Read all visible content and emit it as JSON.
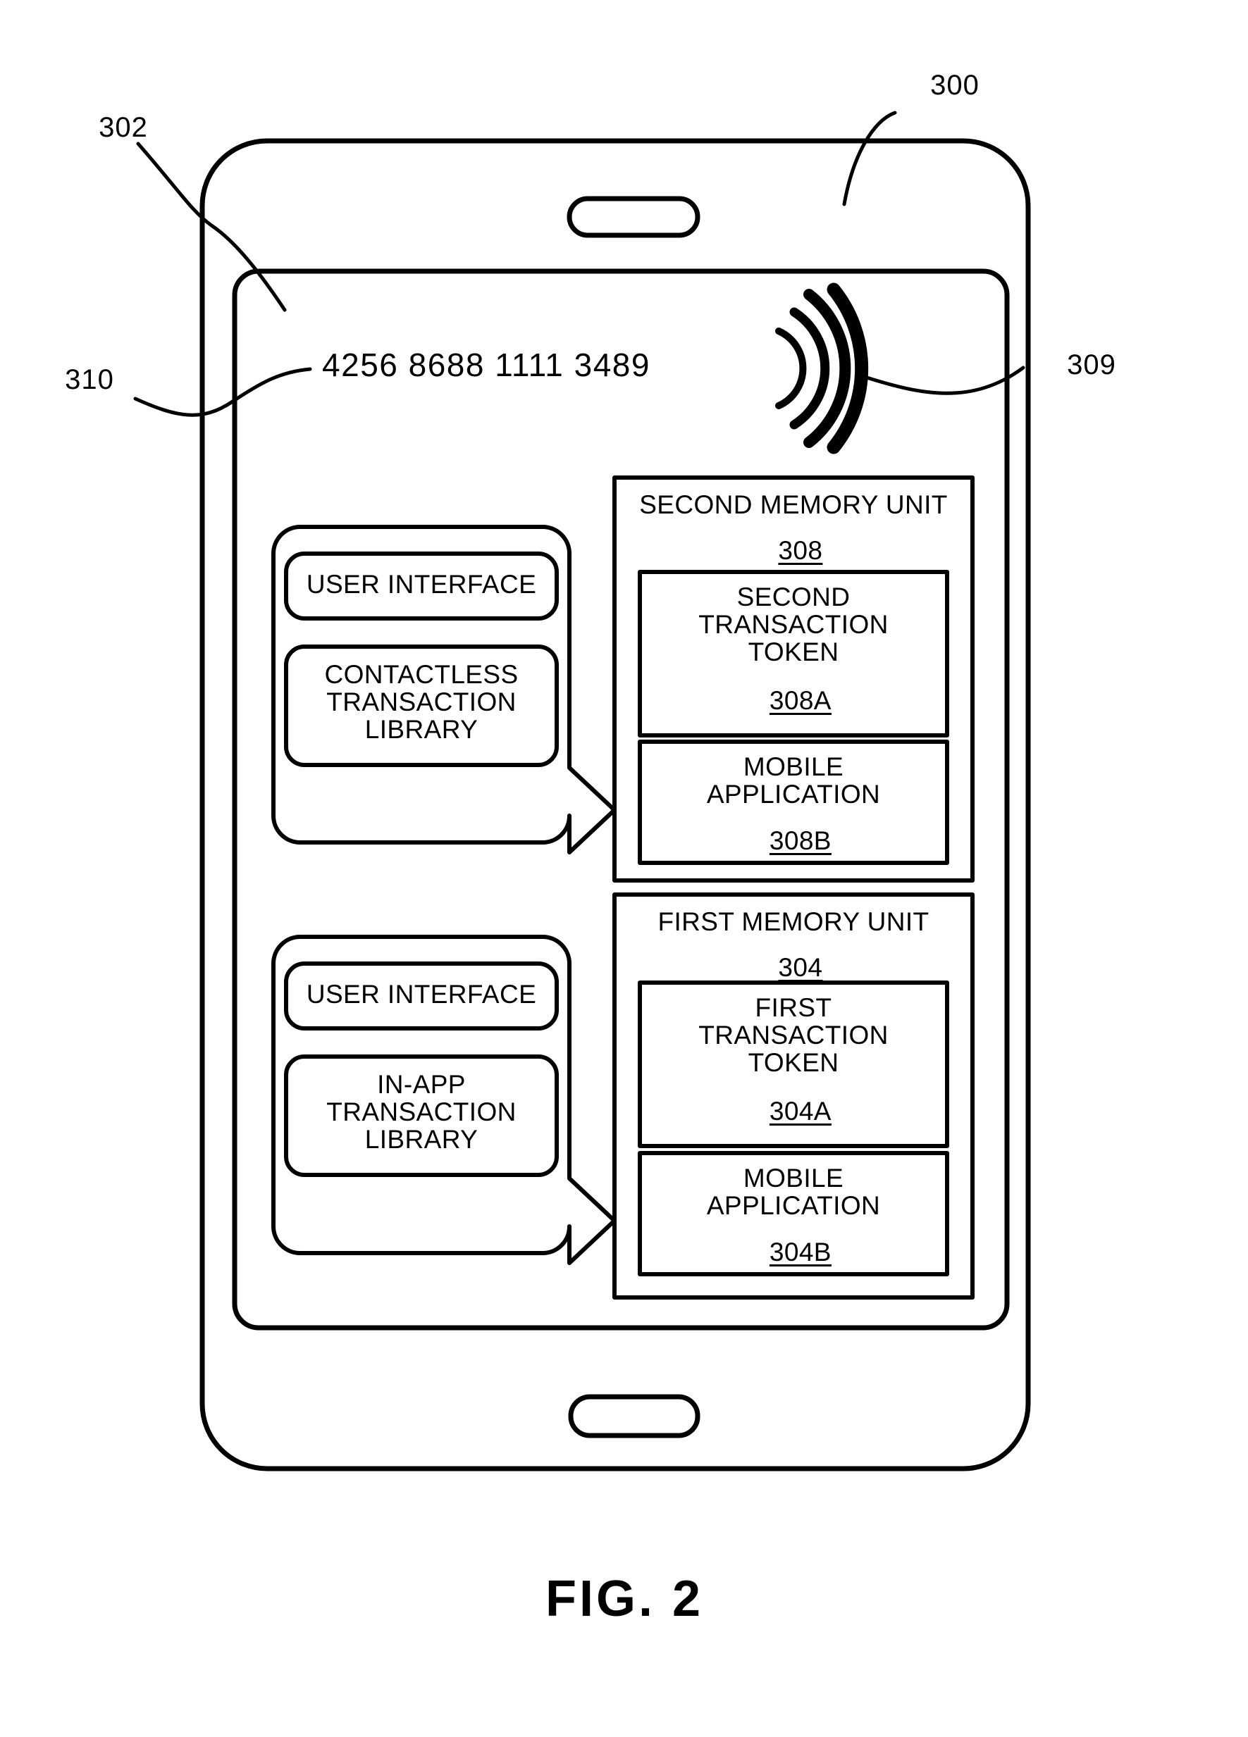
{
  "figure": {
    "caption": "FIG. 2",
    "reference_numerals": {
      "device": "300",
      "screen": "302",
      "card_number": "310",
      "nfc": "309"
    }
  },
  "device": {
    "name": "mobile-device",
    "screen": {
      "card_number": "4256 8688 1111 3489",
      "nfc_icon": "nfc-wave-icon",
      "earpiece_icon": "earpiece-speaker-icon",
      "home_button_icon": "home-button-icon"
    }
  },
  "second_memory_unit": {
    "title": "SECOND MEMORY UNIT",
    "ref": "308",
    "blocks": [
      {
        "label_lines": "SECOND\nTRANSACTION\nTOKEN",
        "ref": "308A"
      },
      {
        "label_lines": "MOBILE\nAPPLICATION",
        "ref": "308B"
      }
    ]
  },
  "first_memory_unit": {
    "title": "FIRST MEMORY UNIT",
    "ref": "304",
    "blocks": [
      {
        "label_lines": "FIRST\nTRANSACTION\nTOKEN",
        "ref": "304A"
      },
      {
        "label_lines": "MOBILE\nAPPLICATION",
        "ref": "304B"
      }
    ]
  },
  "contactless_bubble": {
    "user_interface": "USER INTERFACE",
    "library": "CONTACTLESS\nTRANSACTION\nLIBRARY"
  },
  "inapp_bubble": {
    "user_interface": "USER INTERFACE",
    "library": "IN-APP\nTRANSACTION\nLIBRARY"
  },
  "colors": {
    "line": "#000000",
    "background": "#ffffff"
  }
}
